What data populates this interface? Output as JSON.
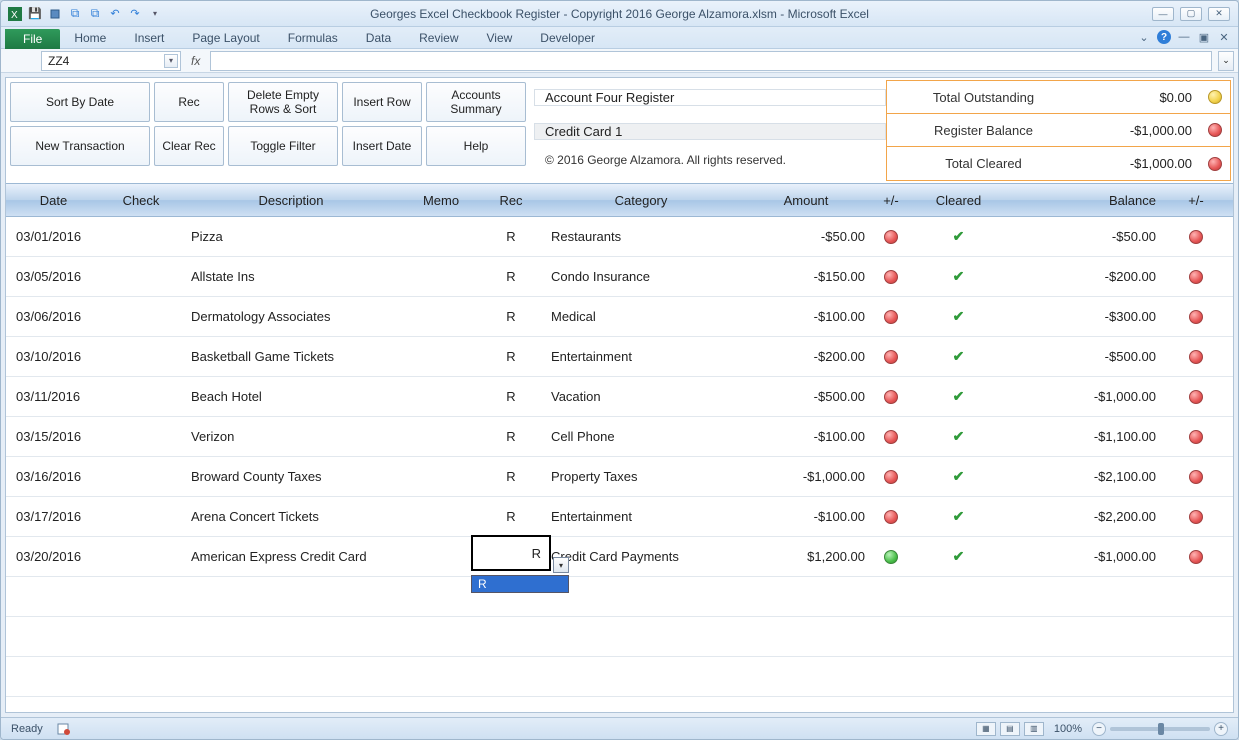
{
  "window": {
    "title": "Georges Excel Checkbook Register - Copyright 2016 George Alzamora.xlsm  -  Microsoft Excel"
  },
  "ribbon": {
    "file": "File",
    "tabs": [
      "Home",
      "Insert",
      "Page Layout",
      "Formulas",
      "Data",
      "Review",
      "View",
      "Developer"
    ]
  },
  "namebox": "ZZ4",
  "buttons": {
    "sort_by_date": "Sort By Date",
    "rec": "Rec",
    "delete_empty": "Delete Empty Rows & Sort",
    "insert_row": "Insert Row",
    "accounts_summary": "Accounts Summary",
    "new_trans": "New Transaction",
    "clear_rec": "Clear Rec",
    "toggle_filter": "Toggle Filter",
    "insert_date": "Insert Date",
    "help": "Help"
  },
  "info": {
    "account": "Account Four Register",
    "account_name": "Credit Card 1",
    "copyright": "© 2016 George Alzamora.  All rights reserved."
  },
  "totals": {
    "outstanding_label": "Total Outstanding",
    "outstanding_value": "$0.00",
    "register_label": "Register Balance",
    "register_value": "-$1,000.00",
    "cleared_label": "Total Cleared",
    "cleared_value": "-$1,000.00"
  },
  "headers": {
    "date": "Date",
    "check": "Check",
    "description": "Description",
    "memo": "Memo",
    "rec": "Rec",
    "category": "Category",
    "amount": "Amount",
    "pm1": "+/-",
    "cleared": "Cleared",
    "balance": "Balance",
    "pm2": "+/-"
  },
  "rows": [
    {
      "date": "03/01/2016",
      "desc": "Pizza",
      "rec": "R",
      "cat": "Restaurants",
      "amt": "-$50.00",
      "pm": "red",
      "clr": true,
      "bal": "-$50.00",
      "pm2": "red"
    },
    {
      "date": "03/05/2016",
      "desc": "Allstate Ins",
      "rec": "R",
      "cat": "Condo Insurance",
      "amt": "-$150.00",
      "pm": "red",
      "clr": true,
      "bal": "-$200.00",
      "pm2": "red"
    },
    {
      "date": "03/06/2016",
      "desc": "Dermatology Associates",
      "rec": "R",
      "cat": "Medical",
      "amt": "-$100.00",
      "pm": "red",
      "clr": true,
      "bal": "-$300.00",
      "pm2": "red"
    },
    {
      "date": "03/10/2016",
      "desc": "Basketball Game Tickets",
      "rec": "R",
      "cat": "Entertainment",
      "amt": "-$200.00",
      "pm": "red",
      "clr": true,
      "bal": "-$500.00",
      "pm2": "red"
    },
    {
      "date": "03/11/2016",
      "desc": "Beach Hotel",
      "rec": "R",
      "cat": "Vacation",
      "amt": "-$500.00",
      "pm": "red",
      "clr": true,
      "bal": "-$1,000.00",
      "pm2": "red"
    },
    {
      "date": "03/15/2016",
      "desc": "Verizon",
      "rec": "R",
      "cat": "Cell Phone",
      "amt": "-$100.00",
      "pm": "red",
      "clr": true,
      "bal": "-$1,100.00",
      "pm2": "red"
    },
    {
      "date": "03/16/2016",
      "desc": "Broward County Taxes",
      "rec": "R",
      "cat": "Property Taxes",
      "amt": "-$1,000.00",
      "pm": "red",
      "clr": true,
      "bal": "-$2,100.00",
      "pm2": "red"
    },
    {
      "date": "03/17/2016",
      "desc": "Arena Concert Tickets",
      "rec": "R",
      "cat": "Entertainment",
      "amt": "-$100.00",
      "pm": "red",
      "clr": true,
      "bal": "-$2,200.00",
      "pm2": "red"
    },
    {
      "date": "03/20/2016",
      "desc": "American Express Credit Card",
      "rec": "R",
      "cat": "Credit Card Payments",
      "amt": "$1,200.00",
      "pm": "green",
      "clr": true,
      "bal": "-$1,000.00",
      "pm2": "red"
    }
  ],
  "selection": {
    "value": "R",
    "dropdown_option": "R"
  },
  "status": {
    "ready": "Ready",
    "zoom": "100%"
  }
}
